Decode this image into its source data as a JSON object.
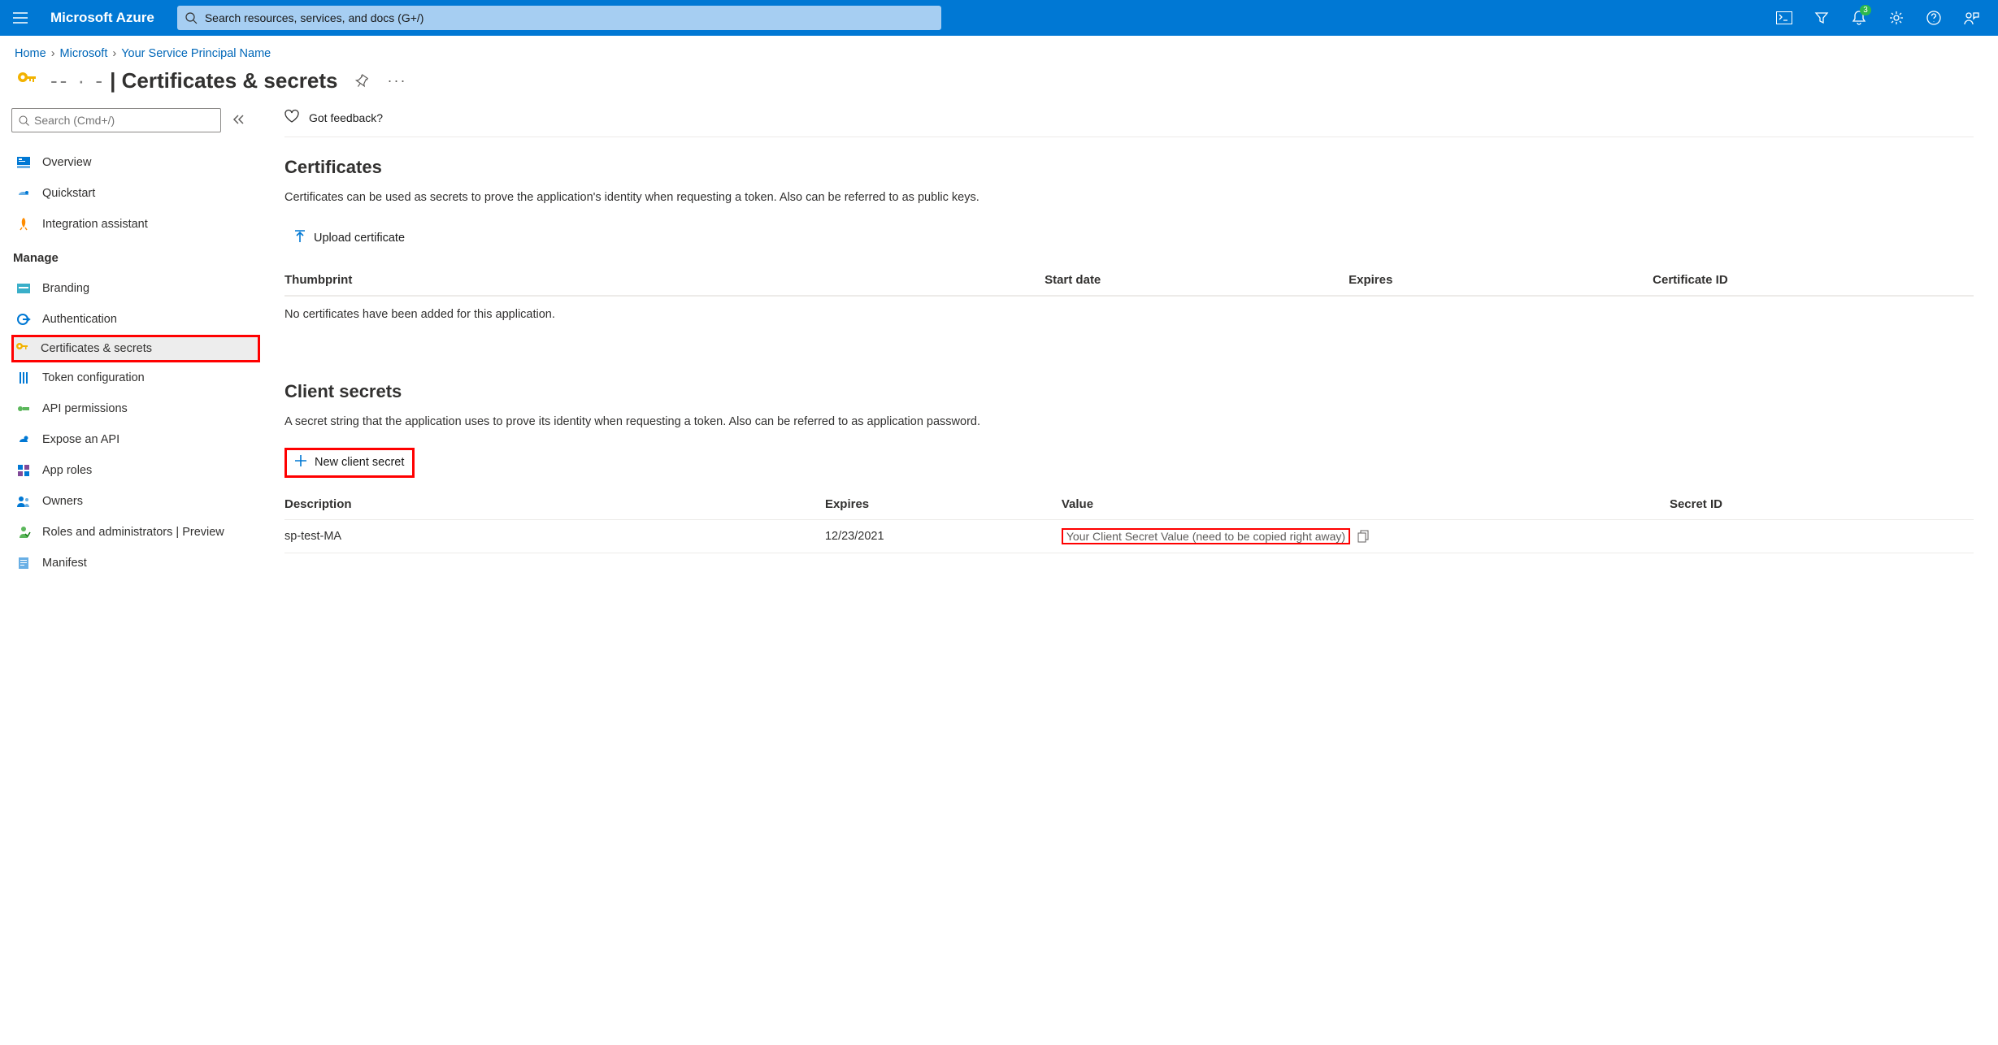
{
  "topbar": {
    "brand": "Microsoft Azure",
    "search_placeholder": "Search resources, services, and docs (G+/)",
    "notification_count": "3"
  },
  "breadcrumb": {
    "items": [
      "Home",
      "Microsoft",
      "Your Service Principal Name"
    ]
  },
  "page": {
    "title_prefix": "",
    "title_main": "| Certificates & secrets"
  },
  "sidebar": {
    "search_placeholder": "Search (Cmd+/)",
    "top_items": [
      {
        "label": "Overview",
        "icon": "overview-icon"
      },
      {
        "label": "Quickstart",
        "icon": "quickstart-icon"
      },
      {
        "label": "Integration assistant",
        "icon": "rocket-icon"
      }
    ],
    "manage_label": "Manage",
    "manage_items": [
      {
        "label": "Branding",
        "icon": "branding-icon"
      },
      {
        "label": "Authentication",
        "icon": "auth-icon"
      },
      {
        "label": "Certificates & secrets",
        "icon": "key-icon",
        "active": true,
        "highlight": true
      },
      {
        "label": "Token configuration",
        "icon": "token-icon"
      },
      {
        "label": "API permissions",
        "icon": "api-perm-icon"
      },
      {
        "label": "Expose an API",
        "icon": "expose-icon"
      },
      {
        "label": "App roles",
        "icon": "roles-icon"
      },
      {
        "label": "Owners",
        "icon": "owners-icon"
      },
      {
        "label": "Roles and administrators | Preview",
        "icon": "roles-admin-icon"
      },
      {
        "label": "Manifest",
        "icon": "manifest-icon"
      }
    ]
  },
  "main": {
    "feedback_label": "Got feedback?",
    "certificates": {
      "heading": "Certificates",
      "description": "Certificates can be used as secrets to prove the application's identity when requesting a token. Also can be referred to as public keys.",
      "upload_label": "Upload certificate",
      "columns": [
        "Thumbprint",
        "Start date",
        "Expires",
        "Certificate ID"
      ],
      "empty": "No certificates have been added for this application."
    },
    "client_secrets": {
      "heading": "Client secrets",
      "description": "A secret string that the application uses to prove its identity when requesting a token. Also can be referred to as application password.",
      "new_label": "New client secret",
      "columns": [
        "Description",
        "Expires",
        "Value",
        "Secret ID"
      ],
      "rows": [
        {
          "description": "sp-test-MA",
          "expires": "12/23/2021",
          "value": "Your Client Secret Value (need to be copied right away)",
          "secret_id": ""
        }
      ]
    }
  },
  "colors": {
    "azure_blue": "#0078d4",
    "highlight_red": "#ff0000"
  }
}
